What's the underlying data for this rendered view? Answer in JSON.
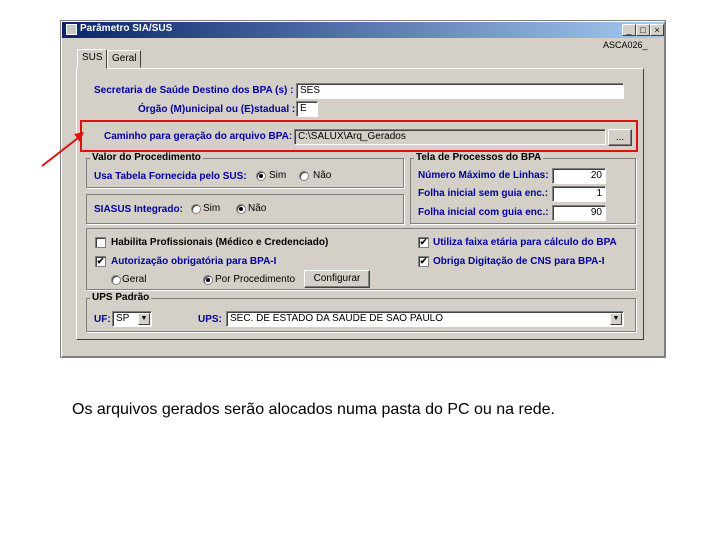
{
  "window": {
    "title": "Parâmetro SIA/SUS",
    "code": "ASCA026_",
    "buttons": {
      "minimize": "_",
      "maximize": "□",
      "close": "×"
    }
  },
  "tabs": [
    {
      "label": "SUS",
      "active": true
    },
    {
      "label": "Geral",
      "active": false
    }
  ],
  "sus": {
    "secretaria_label": "Secretaria de Saúde Destino dos BPA (s) :",
    "secretaria_value": "SES",
    "orgao_label": "Órgão (M)unicipal ou (E)stadual :",
    "orgao_value": "E",
    "caminho_label": "Caminho para geração do arquivo BPA:",
    "caminho_value": "C:\\SALUX\\Arq_Gerados",
    "caminho_button": "..."
  },
  "valor_procedimento": {
    "title": "Valor do Procedimento",
    "tabela_label": "Usa Tabela Fornecida pelo SUS:",
    "tabela_sim": "Sim",
    "tabela_nao": "Não",
    "tabela_selected": "Sim",
    "siasus_label": "SIASUS Integrado:",
    "siasus_sim": "Sim",
    "siasus_nao": "Não",
    "siasus_selected": "Não"
  },
  "tela_processos": {
    "title": "Tela de Processos do BPA",
    "max_linhas_label": "Número Máximo de Linhas:",
    "max_linhas_value": "20",
    "folha_sem_label": "Folha inicial sem guia enc.:",
    "folha_sem_value": "1",
    "folha_com_label": "Folha inicial com guia enc.:",
    "folha_com_value": "90"
  },
  "opcoes": {
    "habilita_label": "Habilita Profissionais (Médico e Credenciado)",
    "habilita_checked": false,
    "autorizacao_label": "Autorização obrigatória para BPA-I",
    "autorizacao_checked": true,
    "geral_label": "Geral",
    "por_procedimento_label": "Por Procedimento",
    "autorizacao_mode_selected": "Por Procedimento",
    "configurar_label": "Configurar",
    "faixa_etaria_label": "Utiliza faixa etária para cálculo do BPA",
    "faixa_etaria_checked": true,
    "cns_label": "Obriga Digitação de CNS para BPA-I",
    "cns_checked": true
  },
  "ups_padrao": {
    "title": "UPS Padrão",
    "uf_label": "UF:",
    "uf_value": "SP",
    "ups_label": "UPS:",
    "ups_value": "SEC. DE ESTADO DA SAUDE DE SAO PAULO"
  },
  "caption": "Os arquivos gerados serão alocados numa pasta do PC ou na rede.",
  "colors": {
    "highlight": "#e01010",
    "label_blue": "#0000a0",
    "titlebar": "#0a246a"
  },
  "icons": {
    "check": "✔",
    "dropdown": "▼"
  }
}
